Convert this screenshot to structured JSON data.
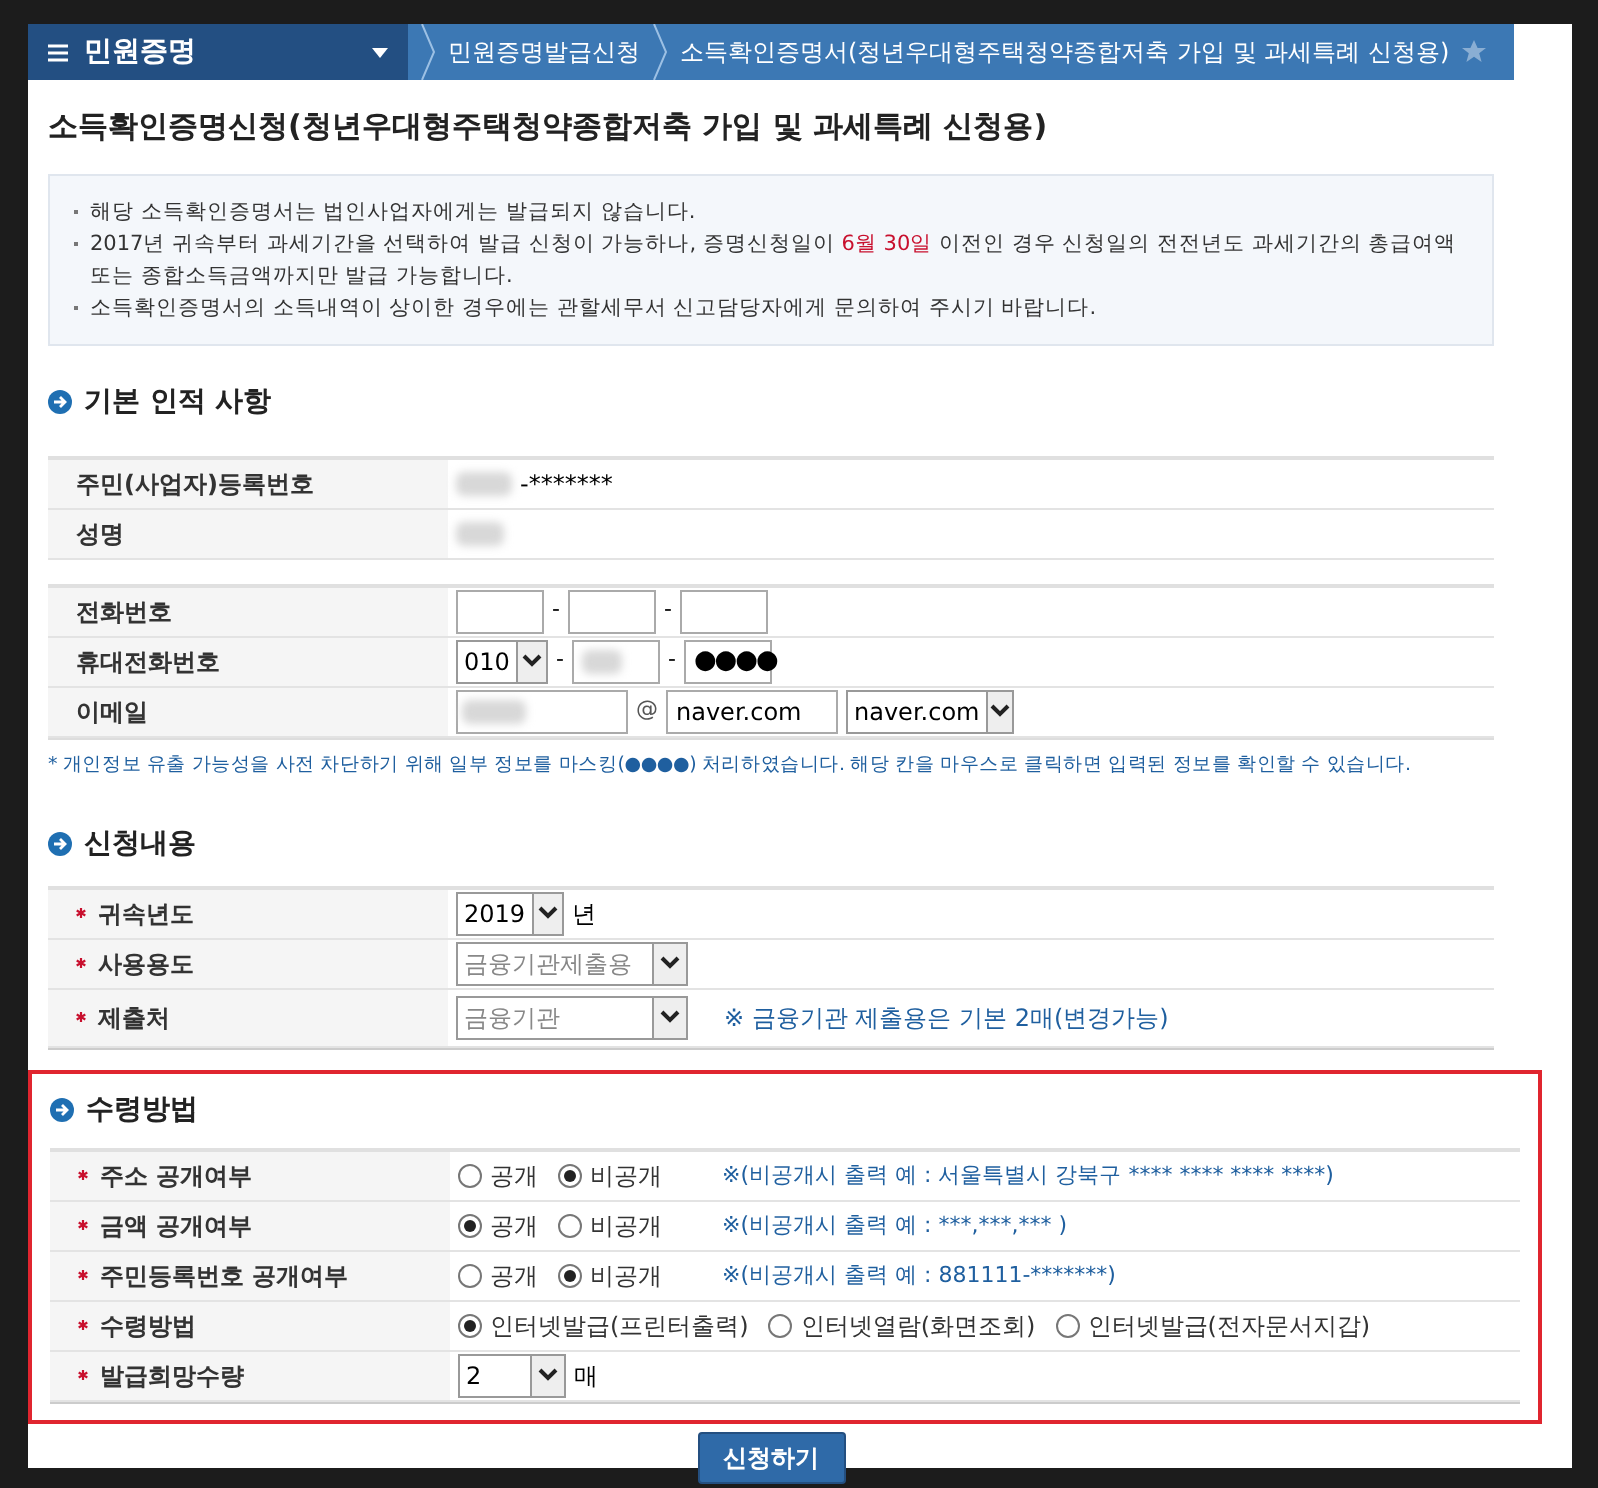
{
  "breadcrumb": {
    "menu_label": "민원증명",
    "items": [
      "민원증명발급신청",
      "소득확인증명서(청년우대형주택청약종합저축 가입 및 과세특례 신청용)"
    ]
  },
  "page_title": "소득확인증명신청(청년우대형주택청약종합저축 가입 및 과세특례 신청용)",
  "notices": [
    {
      "text": "해당 소득확인증명서는 법인사업자에게는 발급되지 않습니다."
    },
    {
      "text": "2017년 귀속부터 과세기간을 선택하여 발급 신청이 가능하나, 증명신청일이 ",
      "highlight": "6월 30일",
      "after": " 이전인 경우 신청일의 전전년도 과세기간의 총급여액 또는 종합소득금액까지만 발급 가능합니다."
    },
    {
      "text": "소득확인증명서의 소득내역이 상이한 경우에는 관할세무서 신고담당자에게 문의하여 주시기 바랍니다."
    }
  ],
  "basic_info": {
    "title": "기본 인적 사항",
    "rrn": {
      "label": "주민(사업자)등록번호",
      "value": "-*******"
    },
    "name": {
      "label": "성명"
    },
    "phone": {
      "label": "전화번호",
      "separators": [
        "-",
        "-"
      ]
    },
    "mobile": {
      "label": "휴대전화번호",
      "prefix": "010",
      "last": "●●●●",
      "separators": [
        "-",
        "-"
      ]
    },
    "email": {
      "label": "이메일",
      "at": "@",
      "domain": "naver.com",
      "domain_select": "naver.com"
    },
    "note": "* 개인정보 유출 가능성을 사전 차단하기 위해 일부 정보를 마스킹(●●●●) 처리하였습니다. 해당 칸을 마우스로 클릭하면 입력된 정보를 확인할 수 있습니다."
  },
  "application": {
    "title": "신청내용",
    "rows": [
      {
        "kind": "select",
        "label": "귀속년도",
        "value": "2019",
        "unit": "년",
        "disabled": false
      },
      {
        "kind": "select",
        "label": "사용용도",
        "value": "금융기관제출용",
        "disabled": true
      },
      {
        "kind": "select",
        "label": "제출처",
        "value": "금융기관",
        "disabled": true,
        "note": "※ 금융기관 제출용은 기본 2매(변경가능)"
      }
    ]
  },
  "receipt": {
    "title": "수령방법",
    "rows": [
      {
        "kind": "radio",
        "label": "주소 공개여부",
        "options": [
          {
            "label": "공개",
            "selected": false
          },
          {
            "label": "비공개",
            "selected": true
          }
        ],
        "note": "※(비공개시 출력 예 : 서울특별시 강북구 **** **** **** ****)"
      },
      {
        "kind": "radio",
        "label": "금액 공개여부",
        "options": [
          {
            "label": "공개",
            "selected": true
          },
          {
            "label": "비공개",
            "selected": false
          }
        ],
        "note": "※(비공개시 출력 예 : ***,***,*** )"
      },
      {
        "kind": "radio",
        "label": "주민등록번호 공개여부",
        "options": [
          {
            "label": "공개",
            "selected": false
          },
          {
            "label": "비공개",
            "selected": true
          }
        ],
        "note": "※(비공개시 출력 예 : 881111-*******)"
      },
      {
        "kind": "radio",
        "label": "수령방법",
        "options": [
          {
            "label": "인터넷발급(프린터출력)",
            "selected": true
          },
          {
            "label": "인터넷열람(화면조회)",
            "selected": false
          },
          {
            "label": "인터넷발급(전자문서지갑)",
            "selected": false
          }
        ]
      },
      {
        "kind": "select",
        "label": "발급희망수량",
        "value": "2",
        "unit": "매",
        "disabled": false
      }
    ]
  },
  "submit_button": "신청하기"
}
